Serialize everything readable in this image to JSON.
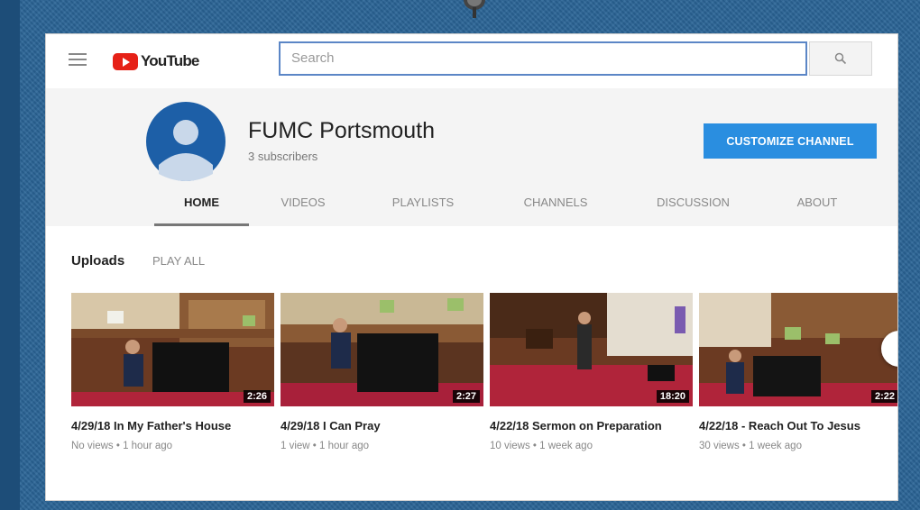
{
  "header": {
    "logo_text": "YouTube",
    "search_placeholder": "Search"
  },
  "channel": {
    "name": "FUMC Portsmouth",
    "subscribers": "3 subscribers",
    "customize_label": "CUSTOMIZE CHANNEL"
  },
  "tabs": [
    {
      "label": "HOME",
      "active": true
    },
    {
      "label": "VIDEOS",
      "active": false
    },
    {
      "label": "PLAYLISTS",
      "active": false
    },
    {
      "label": "CHANNELS",
      "active": false
    },
    {
      "label": "DISCUSSION",
      "active": false
    },
    {
      "label": "ABOUT",
      "active": false
    }
  ],
  "uploads": {
    "title": "Uploads",
    "play_all": "PLAY ALL"
  },
  "videos": [
    {
      "title": "4/29/18 In My Father's House",
      "meta": "No views • 1 hour ago",
      "duration": "2:26"
    },
    {
      "title": "4/29/18 I Can Pray",
      "meta": "1 view • 1 hour ago",
      "duration": "2:27"
    },
    {
      "title": "4/22/18 Sermon on Preparation",
      "meta": "10 views • 1 week ago",
      "duration": "18:20"
    },
    {
      "title": "4/22/18 - Reach Out To Jesus",
      "meta": "30 views • 1 week ago",
      "duration": "2:22"
    }
  ],
  "colors": {
    "accent": "#2a8ee0",
    "youtube_red": "#e62117",
    "background": "#2a6496"
  }
}
